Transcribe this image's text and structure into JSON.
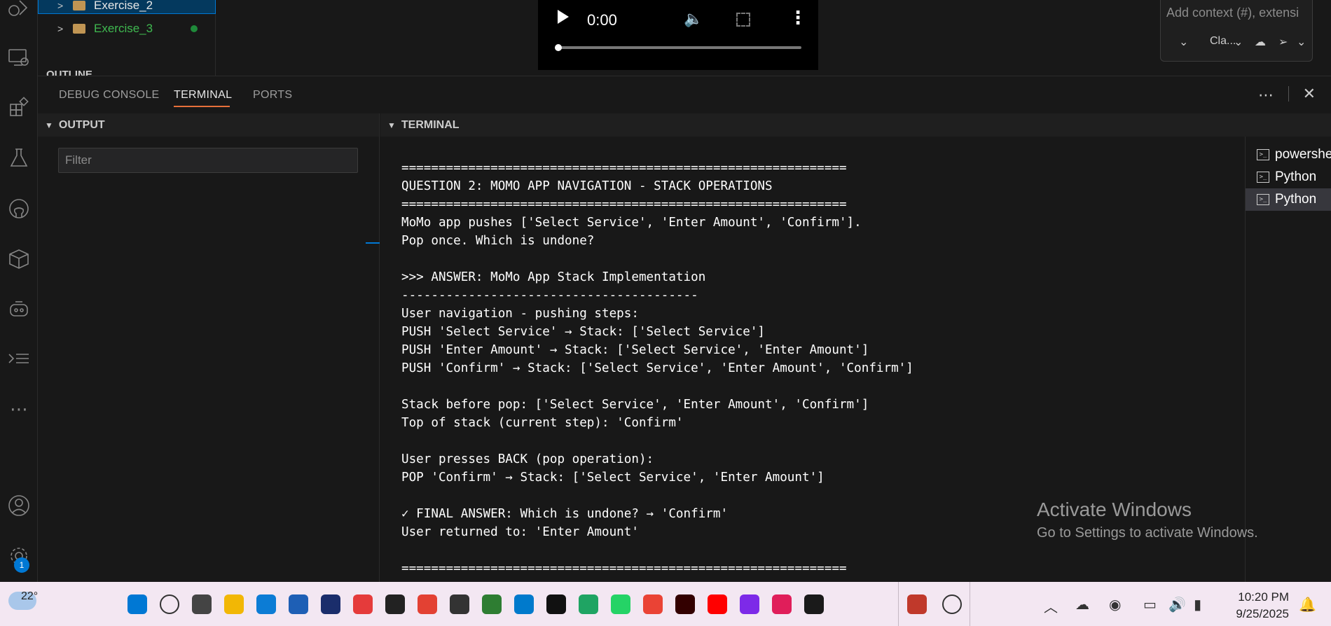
{
  "explorer": {
    "items": [
      {
        "label": "Exercise_2",
        "selected": true
      },
      {
        "label": "Exercise_3",
        "color": "#3fb950",
        "modified": true
      }
    ],
    "outline_label": "OUTLINE"
  },
  "video": {
    "time": "0:00"
  },
  "chat": {
    "placeholder": "Add context (#), extensi",
    "model": "Cla..."
  },
  "panel": {
    "tabs": [
      {
        "label": "DEBUG CONSOLE",
        "active": false
      },
      {
        "label": "TERMINAL",
        "active": true
      },
      {
        "label": "PORTS",
        "active": false
      }
    ]
  },
  "output": {
    "title": "OUTPUT",
    "filter_placeholder": "Filter"
  },
  "terminal": {
    "title": "TERMINAL",
    "lines": [
      "============================================================",
      "QUESTION 2: MOMO APP NAVIGATION - STACK OPERATIONS",
      "============================================================",
      "MoMo app pushes ['Select Service', 'Enter Amount', 'Confirm'].",
      "Pop once. Which is undone?",
      "",
      ">>> ANSWER: MoMo App Stack Implementation",
      "----------------------------------------",
      "User navigation - pushing steps:",
      "PUSH 'Select Service' → Stack: ['Select Service']",
      "PUSH 'Enter Amount' → Stack: ['Select Service', 'Enter Amount']",
      "PUSH 'Confirm' → Stack: ['Select Service', 'Enter Amount', 'Confirm']",
      "",
      "Stack before pop: ['Select Service', 'Enter Amount', 'Confirm']",
      "Top of stack (current step): 'Confirm'",
      "",
      "User presses BACK (pop operation):",
      "POP 'Confirm' → Stack: ['Select Service', 'Enter Amount']",
      "",
      "✓ FINAL ANSWER: Which is undone? → 'Confirm'",
      "User returned to: 'Enter Amount'",
      "",
      "============================================================"
    ],
    "instances": [
      {
        "label": "powershell",
        "active": false
      },
      {
        "label": "Python",
        "active": false
      },
      {
        "label": "Python",
        "active": true
      }
    ]
  },
  "watermark": {
    "line1": "Activate Windows",
    "line2": "Go to Settings to activate Windows."
  },
  "taskbar": {
    "temperature": "22°",
    "time": "10:20 PM",
    "date": "9/25/2025",
    "notification_count": "1",
    "apps": [
      "start-icon",
      "search-icon",
      "task-view-icon",
      "file-explorer-icon",
      "edge-icon",
      "store-icon",
      "alu-icon",
      "heart-app-icon",
      "github-icon",
      "chrome-icon",
      "alx-icon",
      "w3schools-icon",
      "vscode-icon",
      "x-icon",
      "google-drive-icon",
      "whatsapp-icon",
      "gmail-icon",
      "illustrator-icon",
      "youtube-icon",
      "canva-icon",
      "slack-icon",
      "alx-app-icon",
      "snipping-tool-icon",
      "more-icon"
    ]
  }
}
